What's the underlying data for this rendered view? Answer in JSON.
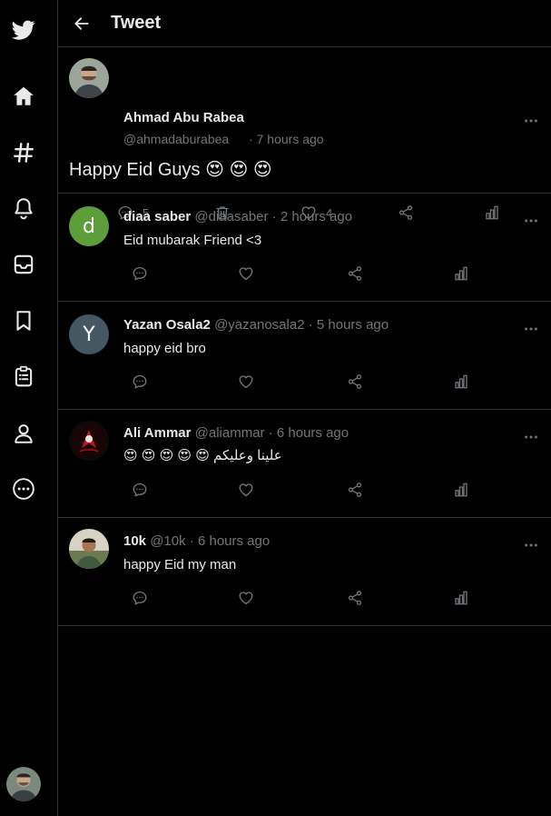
{
  "header": {
    "title": "Tweet"
  },
  "main_tweet": {
    "name": "Ahmad Abu Rabea",
    "handle": "@ahmadaburabea",
    "time": "· 7 hours ago",
    "text": "Happy Eid Guys 😍 😍 😍",
    "replies": "5",
    "likes": "4"
  },
  "replies": [
    {
      "name": "diaa saber",
      "handle": "@diaasaber",
      "sep": "·",
      "time": "2 hours ago",
      "text": "Eid mubarak Friend <3",
      "avatar_letter": "d",
      "avatar_color": "#5c9e3a"
    },
    {
      "name": "Yazan Osala2",
      "handle": "@yazanosala2",
      "sep": "·",
      "time": "5 hours ago",
      "text": "happy eid bro",
      "avatar_letter": "Y",
      "avatar_color": "#455763"
    },
    {
      "name": "Ali Ammar",
      "handle": "@aliammar",
      "sep": "·",
      "time": "6 hours ago",
      "text": "علينا وعليكم 😍 😍 😍 😍 😍"
    },
    {
      "name": "10k",
      "handle": "@10k",
      "sep": "·",
      "time": "6 hours ago",
      "text": "happy Eid my man"
    }
  ],
  "icons": {
    "logo": "twitter-bird-icon",
    "nav": [
      "home-icon",
      "explore-hash-icon",
      "notifications-bell-icon",
      "messages-inbox-icon",
      "bookmark-icon",
      "lists-clipboard-icon",
      "profile-icon",
      "more-circle-icon"
    ]
  },
  "colors": {
    "background": "#000000",
    "text": "#e7e9ea",
    "muted": "#71767b",
    "border": "#2f3336"
  }
}
